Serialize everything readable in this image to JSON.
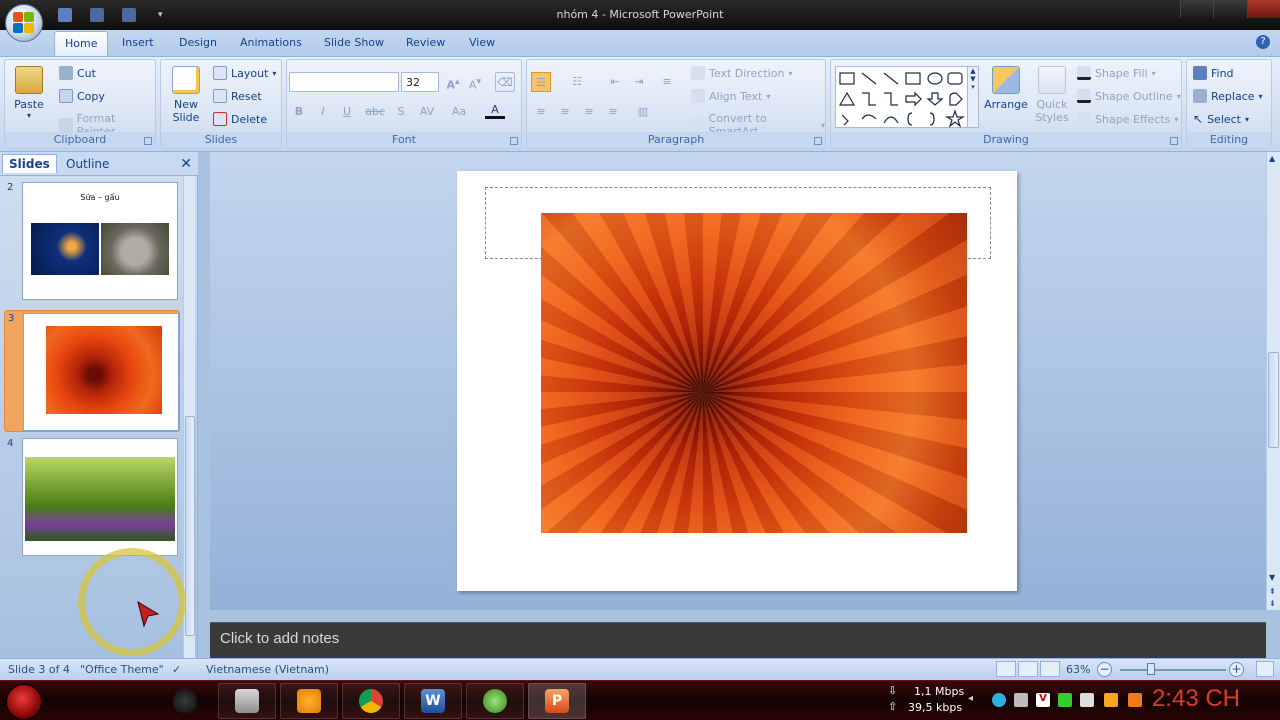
{
  "window": {
    "title": "nhóm 4 - Microsoft PowerPoint"
  },
  "tabs": [
    "Home",
    "Insert",
    "Design",
    "Animations",
    "Slide Show",
    "Review",
    "View"
  ],
  "active_tab": "Home",
  "ribbon": {
    "clipboard": {
      "label": "Clipboard",
      "paste": "Paste",
      "cut": "Cut",
      "copy": "Copy",
      "format_painter": "Format Painter"
    },
    "slides": {
      "label": "Slides",
      "new_slide": "New Slide",
      "layout": "Layout",
      "reset": "Reset",
      "delete": "Delete"
    },
    "font": {
      "label": "Font",
      "font_name": "",
      "font_size": "32"
    },
    "paragraph": {
      "label": "Paragraph",
      "text_direction": "Text Direction",
      "align_text": "Align Text",
      "convert_smartart": "Convert to SmartArt"
    },
    "drawing": {
      "label": "Drawing",
      "arrange": "Arrange",
      "quick_styles": "Quick Styles",
      "shape_fill": "Shape Fill",
      "shape_outline": "Shape Outline",
      "shape_effects": "Shape Effects"
    },
    "editing": {
      "label": "Editing",
      "find": "Find",
      "replace": "Replace",
      "select": "Select"
    }
  },
  "slides_pane": {
    "tab_slides": "Slides",
    "tab_outline": "Outline",
    "thumbnails": [
      {
        "number": "2",
        "title": "Sứa – gấu"
      },
      {
        "number": "3"
      },
      {
        "number": "4"
      }
    ],
    "selected": "3"
  },
  "notes": {
    "placeholder": "Click to add notes"
  },
  "status": {
    "slide_info": "Slide 3 of 4",
    "theme": "\"Office Theme\"",
    "language": "Vietnamese (Vietnam)",
    "zoom": "63%",
    "zoom_level": 0.63
  },
  "taskbar": {
    "download": "1,1 Mbps",
    "upload": "39,5 kbps",
    "clock": "2:43 CH"
  },
  "colors": {
    "ribbon_blue": "#15428b",
    "selection_orange": "#f1a55c",
    "clock_red": "#e23a2a"
  }
}
